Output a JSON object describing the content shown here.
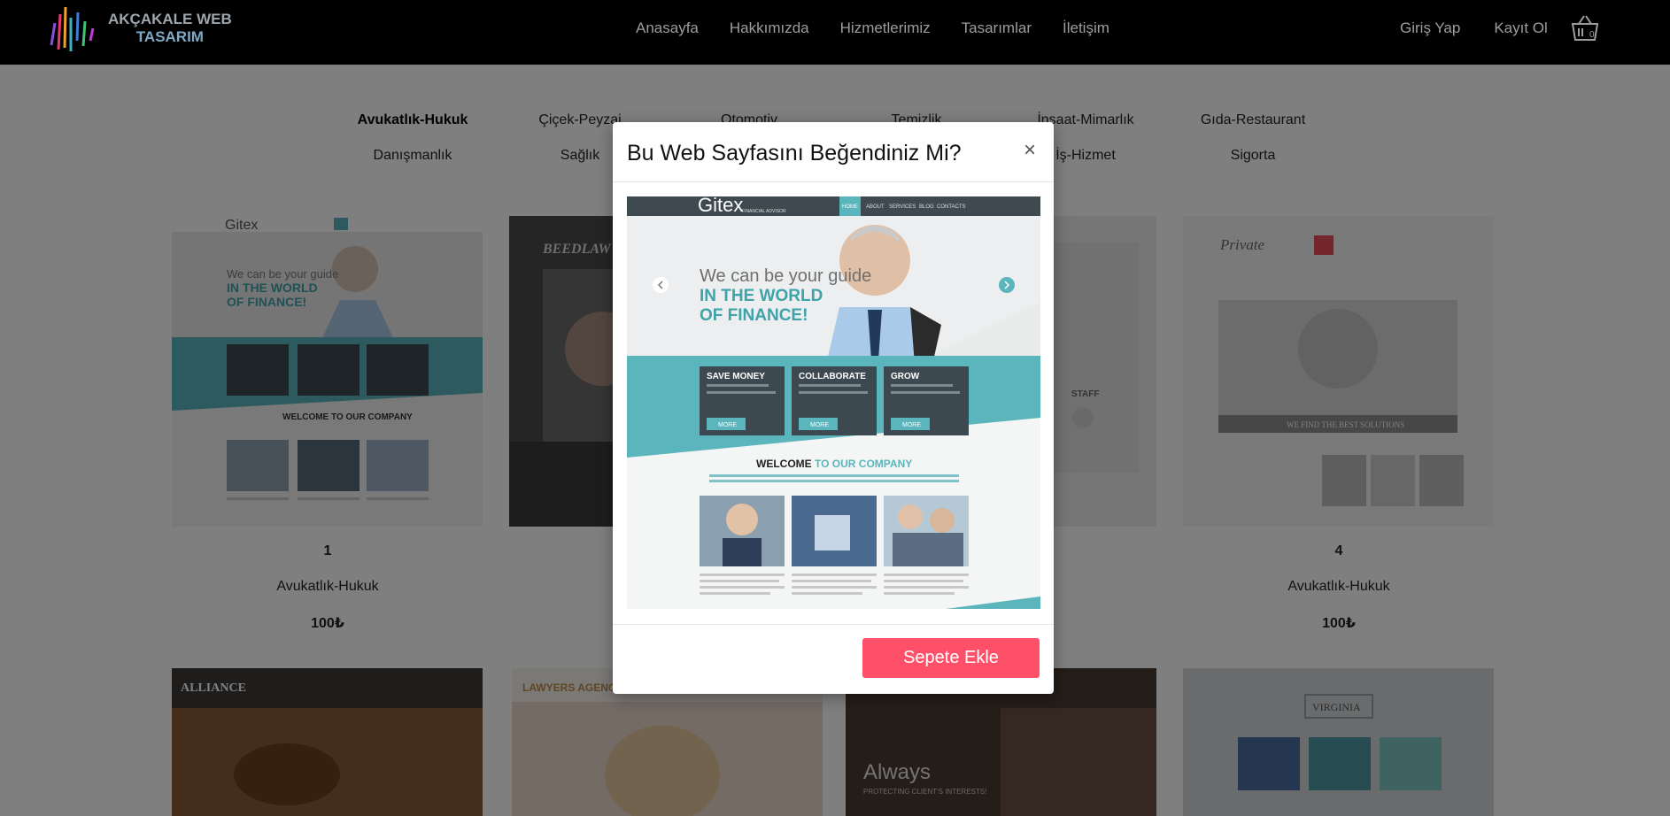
{
  "brand": {
    "line1": "AKÇAKALE WEB",
    "line2": "TASARIM"
  },
  "nav": {
    "items": [
      "Anasayfa",
      "Hakkımızda",
      "Hizmetlerimiz",
      "Tasarımlar",
      "İletişim"
    ],
    "login": "Giriş Yap",
    "register": "Kayıt Ol",
    "cart_count": "0"
  },
  "categories": {
    "row1": [
      "Avukatlık-Hukuk",
      "Çiçek-Peyzaj",
      "Otomotiv",
      "Temizlik",
      "İnşaat-Mimarlık",
      "Gıda-Restaurant"
    ],
    "row2": [
      "Danışmanlık",
      "Sağlık",
      "İş-Hizmet",
      "Sigorta"
    ]
  },
  "products": [
    {
      "num": "1",
      "name": "Avukatlık-Hukuk",
      "price": "100₺"
    },
    {
      "num": "4",
      "name": "Avukatlık-Hukuk",
      "price": "100₺"
    }
  ],
  "modal": {
    "title": "Bu Web Sayfasını Beğendiniz Mi?",
    "close": "×",
    "button": "Sepete Ekle",
    "preview": {
      "logo": "Gitex",
      "tagline": "FINANCIAL ADVISOR",
      "menu": [
        "HOME",
        "ABOUT",
        "SERVICES",
        "BLOG",
        "CONTACTS"
      ],
      "hero_line1": "We can be your guide",
      "hero_line2": "IN THE WORLD",
      "hero_line3": "OF FINANCE!",
      "boxes": [
        "SAVE MONEY",
        "COLLABORATE",
        "GROW"
      ],
      "more": "MORE",
      "welcome_a": "WELCOME",
      "welcome_b": " TO OUR COMPANY"
    }
  },
  "thumbs": {
    "t1_logo": "Gitex",
    "t2_logo": "BEEDLAW",
    "t4_logo": "Private",
    "t4_caption": "WE FIND THE BEST SOLUTIONS",
    "t3_label": "STAFF",
    "b1_logo": "ALLIANCE",
    "b2_logo": "LAWYERS AGENCY",
    "b3_text": "Always",
    "b3_sub": "PROTECTING CLIENT'S INTERESTS!",
    "b4_logo": "VIRGINIA"
  }
}
